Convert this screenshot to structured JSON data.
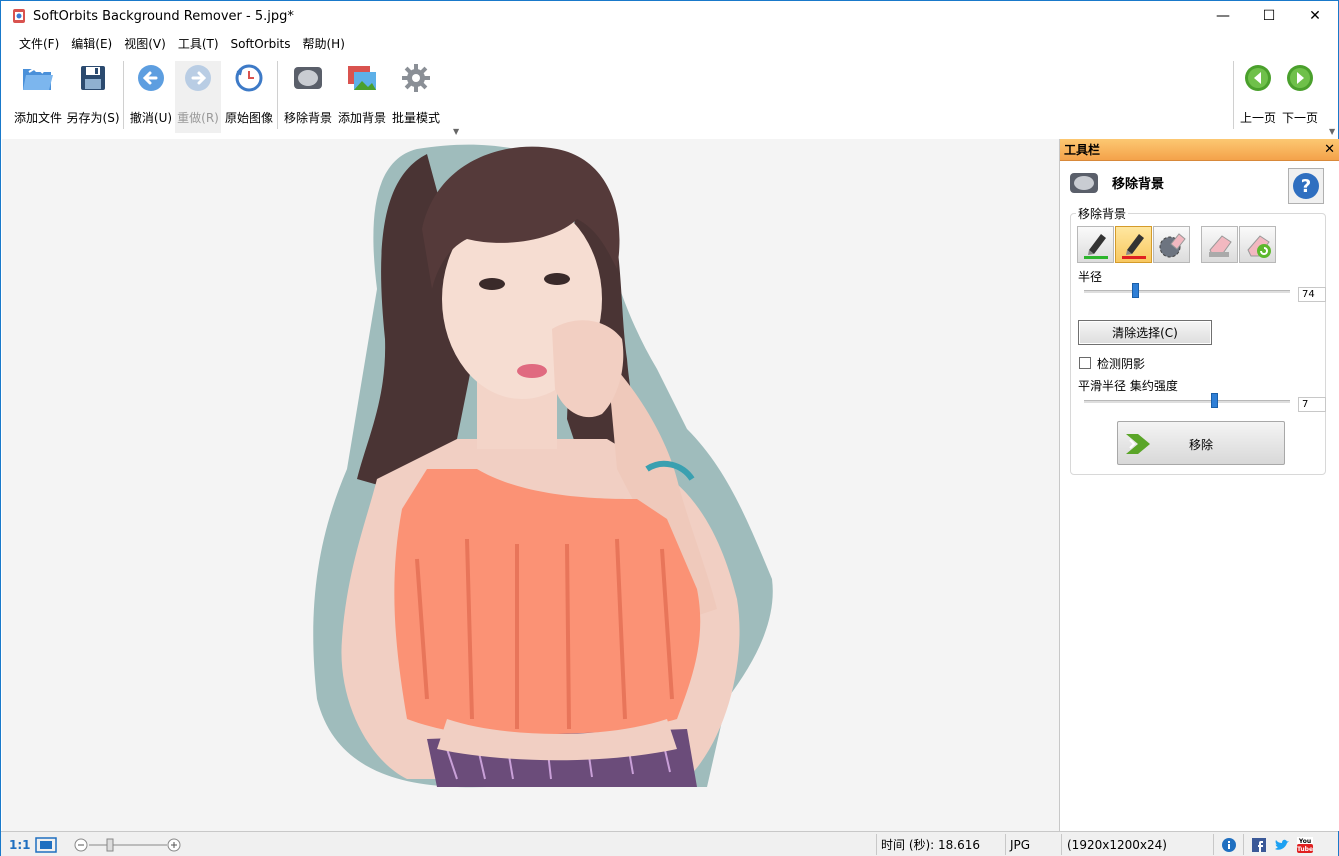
{
  "window": {
    "title": "SoftOrbits Background Remover - 5.jpg*",
    "minimize": "—",
    "maximize": "☐",
    "close": "✕"
  },
  "menu": [
    "文件(F)",
    "编辑(E)",
    "视图(V)",
    "工具(T)",
    "SoftOrbits",
    "帮助(H)"
  ],
  "toolbar": {
    "add_file": "添加文件",
    "save_as": "另存为(S)",
    "undo": "撤消(U)",
    "redo": "重做(R)",
    "original": "原始图像",
    "remove_bg": "移除背景",
    "add_bg": "添加背景",
    "batch": "批量模式",
    "prev": "上一页",
    "next": "下一页"
  },
  "panel": {
    "header": "工具栏",
    "close": "✕",
    "section_title": "移除背景",
    "help": "?",
    "group_label": "移除背景",
    "radius_label": "半径",
    "radius_value": "74",
    "radius_fraction": 0.24,
    "clear_button": "清除选择(C)",
    "detect_shadow": "检测阴影",
    "detect_shadow_checked": false,
    "smooth_label": "平滑半径 集约强度",
    "smooth_value": "7",
    "smooth_fraction": 0.64,
    "remove_button": "移除"
  },
  "status": {
    "zoom_1to1": "1:1",
    "time": "时间 (秒): 18.616",
    "format": "JPG",
    "dimensions": "(1920x1200x24)",
    "social": [
      "info-icon",
      "facebook-icon",
      "twitter-icon",
      "youtube-icon"
    ]
  },
  "colors": {
    "accent": "#1979ca",
    "panel_header": "#f6ae55",
    "slider_thumb": "#2f7fd6",
    "green_arrow": "#4aa02c"
  }
}
